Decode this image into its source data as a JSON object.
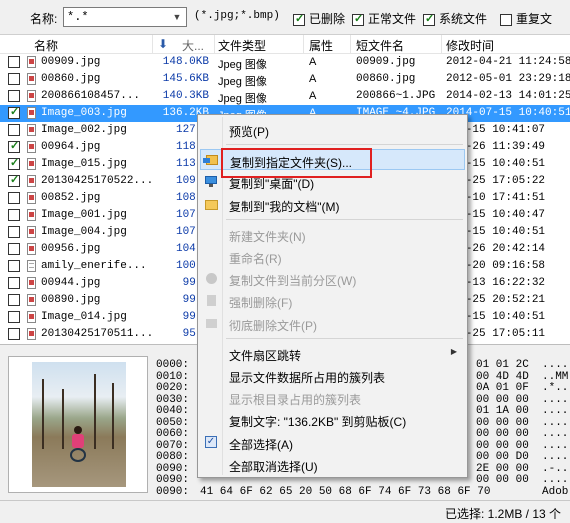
{
  "filter": {
    "name_label": "名称:",
    "name_value": "*.*",
    "ext_hint": "(*.jpg;*.bmp)",
    "options": [
      {
        "label": "已删除",
        "checked": true
      },
      {
        "label": "正常文件",
        "checked": true
      },
      {
        "label": "系统文件",
        "checked": true
      },
      {
        "label": "重复文",
        "checked": false
      }
    ]
  },
  "columns": {
    "name": "名称",
    "size_sort_icon": "arrow-down-icon",
    "size": "大...",
    "type": "文件类型",
    "attr": "属性",
    "short": "短文件名",
    "time": "修改时间"
  },
  "rows": [
    {
      "checked": false,
      "name": "00909.jpg",
      "size": "148.0KB",
      "type": "Jpeg 图像",
      "attr": "A",
      "short": "00909.jpg",
      "time": "2012-04-21 11:24:58",
      "selected": false,
      "icon": "image"
    },
    {
      "checked": false,
      "name": "00860.jpg",
      "size": "145.6KB",
      "type": "Jpeg 图像",
      "attr": "A",
      "short": "00860.jpg",
      "time": "2012-05-01 23:29:18",
      "selected": false,
      "icon": "image"
    },
    {
      "checked": false,
      "name": "200866108457...",
      "size": "140.3KB",
      "type": "Jpeg 图像",
      "attr": "A",
      "short": "200866~1.JPG",
      "time": "2014-02-13 14:01:25",
      "selected": false,
      "icon": "image"
    },
    {
      "checked": true,
      "name": "Image_003.jpg",
      "size": "136.2KB",
      "type": "Jpeg 图像",
      "attr": "A",
      "short": "IMAGE_~4.JPG",
      "time": "2014-07-15 10:40:51",
      "selected": true,
      "icon": "image"
    },
    {
      "checked": false,
      "name": "Image_002.jpg",
      "size": "127.3",
      "type": "",
      "attr": "",
      "short": "",
      "time": "-07-15 10:41:07",
      "selected": false,
      "icon": "image"
    },
    {
      "checked": true,
      "name": "00964.jpg",
      "size": "118.4",
      "type": "",
      "attr": "",
      "short": "",
      "time": "-04-26 11:39:49",
      "selected": false,
      "icon": "image"
    },
    {
      "checked": true,
      "name": "Image_015.jpg",
      "size": "113.9",
      "type": "",
      "attr": "",
      "short": "",
      "time": "-07-15 10:40:51",
      "selected": false,
      "icon": "image"
    },
    {
      "checked": true,
      "name": "20130425170522...",
      "size": "109.1",
      "type": "",
      "attr": "",
      "short": "",
      "time": "-04-25 17:05:22",
      "selected": false,
      "icon": "image"
    },
    {
      "checked": false,
      "name": "00852.jpg",
      "size": "108.6",
      "type": "",
      "attr": "",
      "short": "",
      "time": "-04-10 17:41:51",
      "selected": false,
      "icon": "image"
    },
    {
      "checked": false,
      "name": "Image_001.jpg",
      "size": "107.7",
      "type": "",
      "attr": "",
      "short": "",
      "time": "-07-15 10:40:47",
      "selected": false,
      "icon": "image"
    },
    {
      "checked": false,
      "name": "Image_004.jpg",
      "size": "107.1",
      "type": "",
      "attr": "",
      "short": "",
      "time": "-07-15 10:40:51",
      "selected": false,
      "icon": "image"
    },
    {
      "checked": false,
      "name": "00956.jpg",
      "size": "104.8",
      "type": "",
      "attr": "",
      "short": "",
      "time": "-04-26 20:42:14",
      "selected": false,
      "icon": "image"
    },
    {
      "checked": false,
      "name": "amily_enerife...",
      "size": "100.4",
      "type": "",
      "attr": "",
      "short": "",
      "time": "-03-20 09:16:58",
      "selected": false,
      "icon": "doc"
    },
    {
      "checked": false,
      "name": "00944.jpg",
      "size": "99.5",
      "type": "",
      "attr": "",
      "short": "",
      "time": "-12-13 16:22:32",
      "selected": false,
      "icon": "image"
    },
    {
      "checked": false,
      "name": "00890.jpg",
      "size": "99.0",
      "type": "",
      "attr": "",
      "short": "",
      "time": "-04-25 20:52:21",
      "selected": false,
      "icon": "image"
    },
    {
      "checked": false,
      "name": "Image_014.jpg",
      "size": "99.5",
      "type": "",
      "attr": "",
      "short": "",
      "time": "-07-15 10:40:51",
      "selected": false,
      "icon": "image"
    },
    {
      "checked": false,
      "name": "20130425170511...",
      "size": "95.3",
      "type": "",
      "attr": "",
      "short": "",
      "time": "-04-25 17:05:11",
      "selected": false,
      "icon": "image"
    }
  ],
  "hex": [
    {
      "offset": "0000:",
      "tail": "01 01 2C",
      "ascii": "...."
    },
    {
      "offset": "0010:",
      "tail": "00 4D 4D",
      "ascii": "..MM"
    },
    {
      "offset": "0020:",
      "tail": "0A 01 0F",
      "ascii": ".*.."
    },
    {
      "offset": "0030:",
      "tail": "00 00 00",
      "ascii": "...."
    },
    {
      "offset": "0040:",
      "tail": "01 1A 00",
      "ascii": "...."
    },
    {
      "offset": "0050:",
      "tail": "00 00 00",
      "ascii": "...."
    },
    {
      "offset": "0060:",
      "tail": "00 00 00",
      "ascii": "...."
    },
    {
      "offset": "0070:",
      "tail": "00 00 00",
      "ascii": "...."
    },
    {
      "offset": "0080:",
      "tail": "00 00 D0",
      "ascii": "...."
    },
    {
      "offset": "0090:",
      "tail": "2E 00 00",
      "ascii": ".-.."
    },
    {
      "offset": "0090:",
      "tail": "00 00 00",
      "ascii": "...."
    },
    {
      "offset": "0090:",
      "tail": "41 64 6F 62 65 20 50 68 6F 74 6F 73 68 6F 70",
      "ascii": "Adob"
    }
  ],
  "status": "已选择: 1.2MB / 13 个",
  "menu": [
    {
      "type": "item",
      "label": "预览(P)",
      "disabled": false,
      "icon": ""
    },
    {
      "type": "sep"
    },
    {
      "type": "item",
      "label": "复制到指定文件夹(S)...",
      "disabled": false,
      "icon": "copy-to-folder-icon",
      "highlight": true
    },
    {
      "type": "item",
      "label": "复制到\"桌面\"(D)",
      "disabled": false,
      "icon": "desktop-icon"
    },
    {
      "type": "item",
      "label": "复制到\"我的文档\"(M)",
      "disabled": false,
      "icon": "folder-icon"
    },
    {
      "type": "sep"
    },
    {
      "type": "item",
      "label": "新建文件夹(N)",
      "disabled": true,
      "icon": ""
    },
    {
      "type": "item",
      "label": "重命名(R)",
      "disabled": true,
      "icon": ""
    },
    {
      "type": "item",
      "label": "复制文件到当前分区(W)",
      "disabled": true,
      "icon": "partition-icon"
    },
    {
      "type": "item",
      "label": "强制删除(F)",
      "disabled": true,
      "icon": "force-delete-icon"
    },
    {
      "type": "item",
      "label": "彻底删除文件(P)",
      "disabled": true,
      "icon": "erase-icon"
    },
    {
      "type": "sep"
    },
    {
      "type": "item",
      "label": "文件扇区跳转",
      "disabled": false,
      "icon": "",
      "submenu": true
    },
    {
      "type": "item",
      "label": "显示文件数据所占用的簇列表",
      "disabled": false,
      "icon": ""
    },
    {
      "type": "item",
      "label": "显示根目录占用的簇列表",
      "disabled": true,
      "icon": ""
    },
    {
      "type": "item",
      "label": "复制文字: \"136.2KB\" 到剪贴板(C)",
      "disabled": false,
      "icon": ""
    },
    {
      "type": "item",
      "label": "全部选择(A)",
      "disabled": false,
      "icon": "check-all-icon"
    },
    {
      "type": "item",
      "label": "全部取消选择(U)",
      "disabled": false,
      "icon": ""
    }
  ],
  "colors": {
    "selection": "#3399ff",
    "size_text": "#0b3aa8",
    "highlight_frame": "#e02020"
  }
}
